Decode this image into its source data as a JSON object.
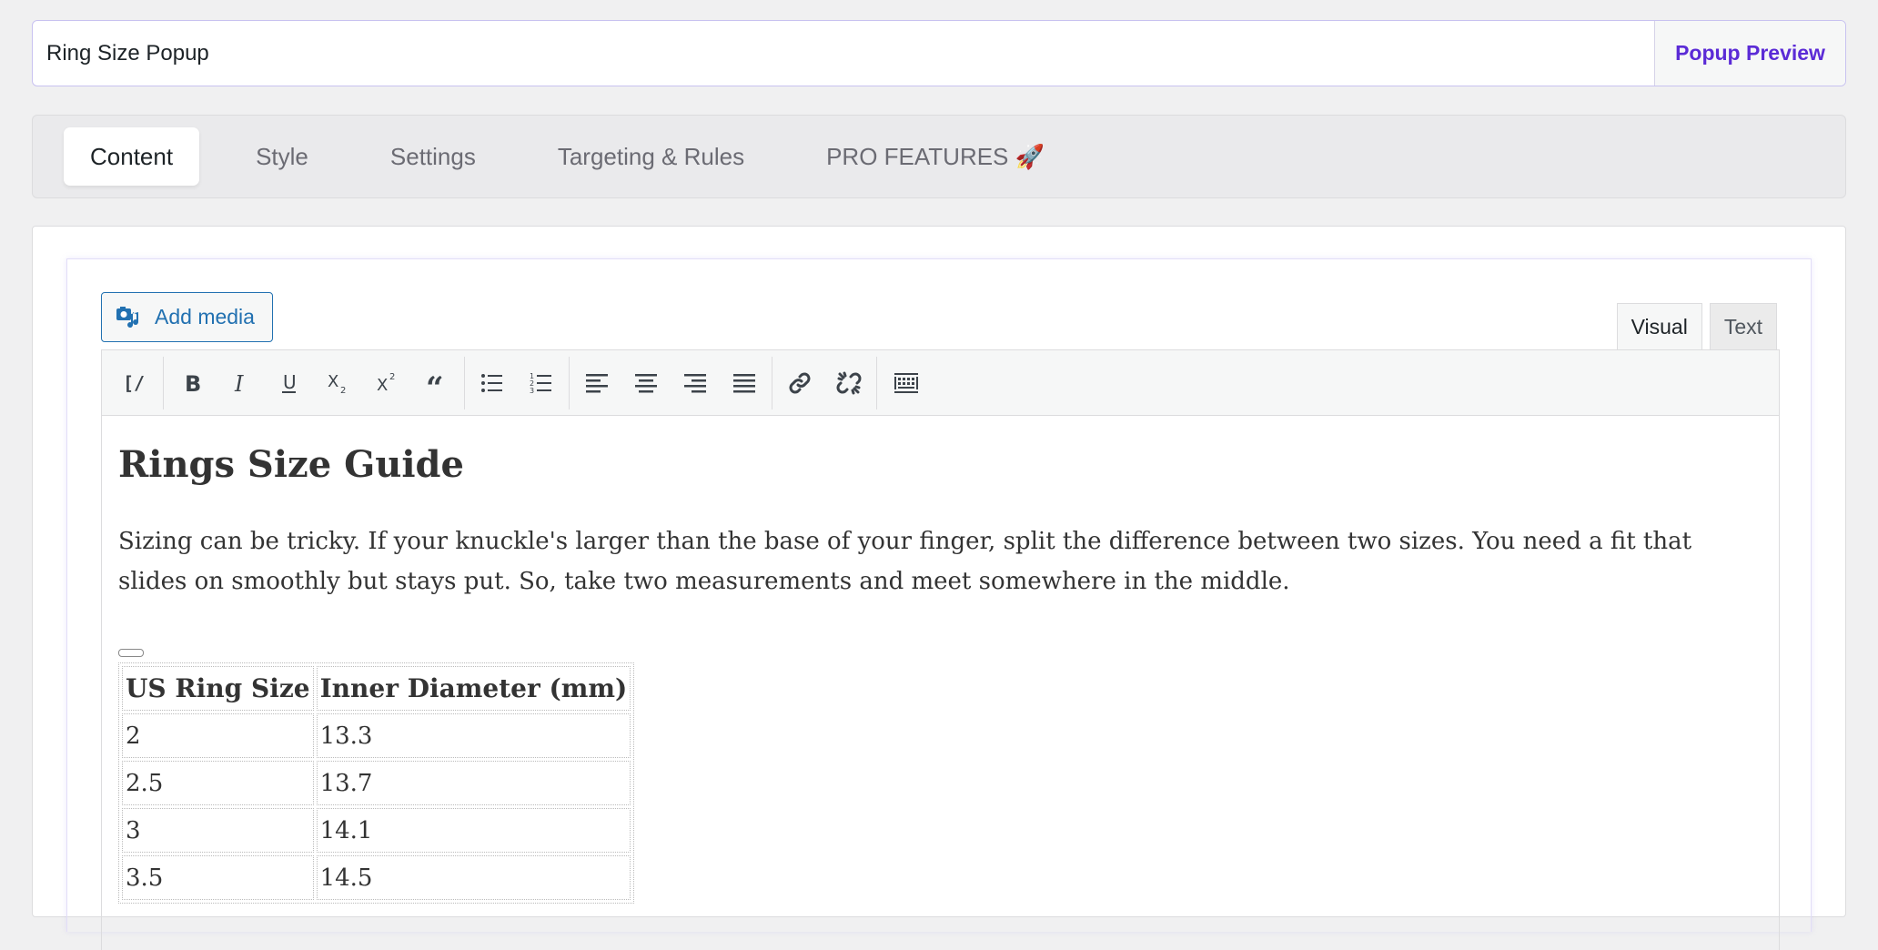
{
  "title": {
    "value": "Ring Size Popup",
    "preview_label": "Popup Preview"
  },
  "tabs": [
    {
      "label": "Content",
      "active": true
    },
    {
      "label": "Style"
    },
    {
      "label": "Settings"
    },
    {
      "label": "Targeting & Rules"
    },
    {
      "label": "PRO FEATURES 🚀"
    }
  ],
  "editor": {
    "add_media_label": "Add media",
    "mode_visual": "Visual",
    "mode_text": "Text",
    "heading": "Rings Size Guide",
    "paragraph": "Sizing can be tricky. If your knuckle's larger than the base of your finger, split the difference between two sizes. You need a fit that slides on smoothly but stays put. So, take two measurements and meet somewhere in the middle.",
    "table": {
      "headers": [
        "US Ring Size",
        "Inner Diameter (mm)"
      ],
      "rows": [
        [
          "2",
          "13.3"
        ],
        [
          "2.5",
          "13.7"
        ],
        [
          "3",
          "14.1"
        ],
        [
          "3.5",
          "14.5"
        ]
      ]
    }
  },
  "colors": {
    "accent": "#5b2bd6",
    "link": "#2271b1"
  }
}
